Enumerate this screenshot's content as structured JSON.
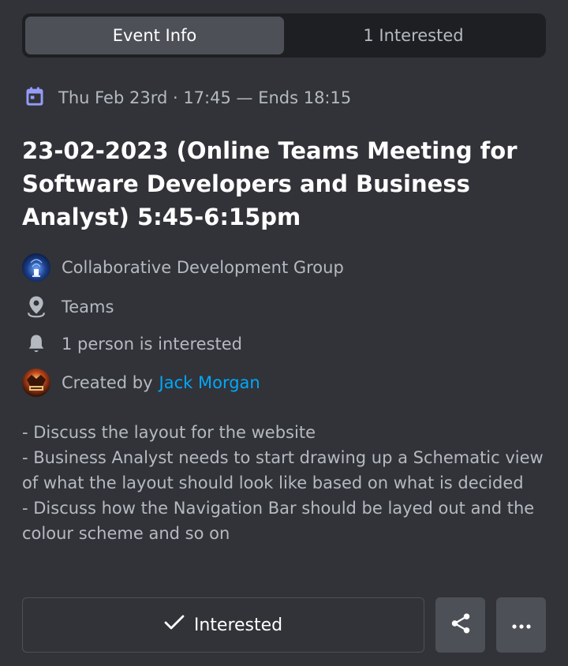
{
  "tabs": [
    {
      "label": "Event Info",
      "active": true
    },
    {
      "label": "1 Interested",
      "active": false
    }
  ],
  "event": {
    "date_text": "Thu Feb 23rd · 17:45 — Ends 18:15",
    "title": "23-02-2023 (Online Teams Meeting for Software Developers and Business Analyst) 5:45-6:15pm",
    "server_name": "Collaborative Development Group",
    "location": "Teams",
    "interested_text": "1 person is interested",
    "created_by_prefix": "Created by",
    "creator_name": "Jack Morgan",
    "description": "- Discuss the layout for the website\n- Business Analyst needs to start drawing up a Schematic view of what the layout should look like based on what is decided\n- Discuss how the Navigation Bar should be layed out and the colour scheme and so on"
  },
  "actions": {
    "interested_label": "Interested",
    "share_icon": "share-icon",
    "more_icon": "more-icon"
  },
  "colors": {
    "background": "#313338",
    "accent_calendar": "#949cf7",
    "link": "#00a8fc"
  }
}
